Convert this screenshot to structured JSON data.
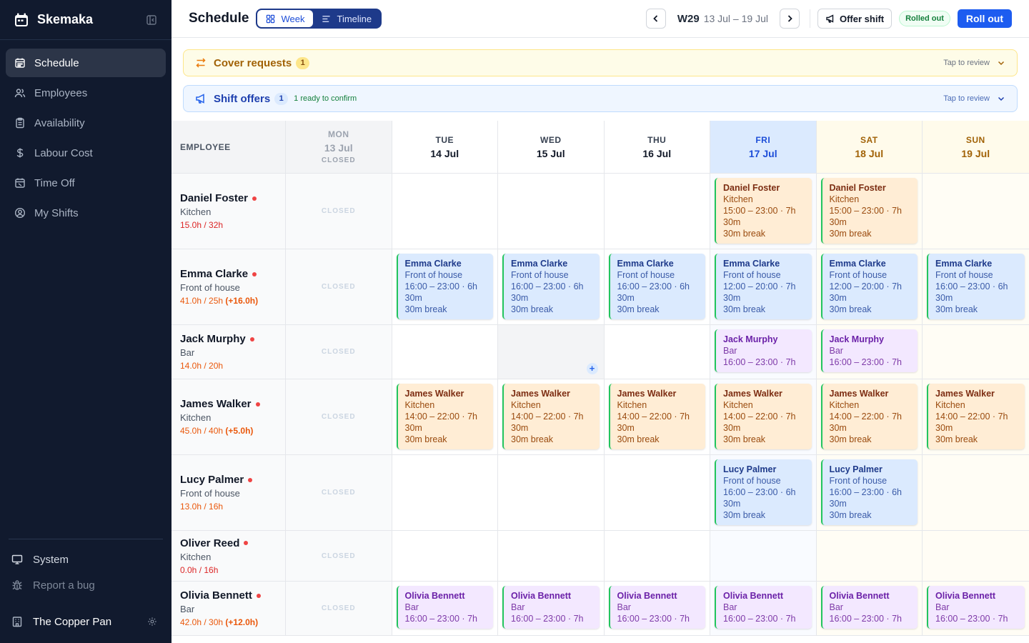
{
  "app": {
    "name": "Skemaka"
  },
  "sidebar": {
    "items": [
      {
        "label": "Schedule",
        "icon": "calendar-icon",
        "active": true
      },
      {
        "label": "Employees",
        "icon": "users-icon",
        "active": false
      },
      {
        "label": "Availability",
        "icon": "clipboard-icon",
        "active": false
      },
      {
        "label": "Labour Cost",
        "icon": "dollar-icon",
        "active": false
      },
      {
        "label": "Time Off",
        "icon": "calendar-off-icon",
        "active": false
      },
      {
        "label": "My Shifts",
        "icon": "user-circle-icon",
        "active": false
      }
    ],
    "system_label": "System",
    "report_label": "Report a bug",
    "org_name": "The Copper Pan"
  },
  "header": {
    "title": "Schedule",
    "views": {
      "week": "Week",
      "timeline": "Timeline"
    },
    "week_code": "W29",
    "week_range": "13 Jul – 19 Jul",
    "offer_shift_label": "Offer shift",
    "status_badge": "Rolled out",
    "rollout_label": "Roll out"
  },
  "banners": {
    "cover": {
      "title": "Cover requests",
      "count": "1",
      "tap": "Tap to review"
    },
    "offers": {
      "title": "Shift offers",
      "count": "1",
      "ready": "1 ready to confirm",
      "tap": "Tap to review"
    }
  },
  "grid": {
    "employee_header": "EMPLOYEE",
    "closed_label": "CLOSED",
    "days": [
      {
        "name": "MON",
        "date": "13 Jul",
        "closed_note": "CLOSED"
      },
      {
        "name": "TUE",
        "date": "14 Jul"
      },
      {
        "name": "WED",
        "date": "15 Jul"
      },
      {
        "name": "THU",
        "date": "16 Jul"
      },
      {
        "name": "FRI",
        "date": "17 Jul"
      },
      {
        "name": "SAT",
        "date": "18 Jul"
      },
      {
        "name": "SUN",
        "date": "19 Jul"
      }
    ],
    "employees": [
      {
        "name": "Daniel Foster",
        "role": "Kitchen",
        "hours": "15.0h / 32h",
        "over": ""
      },
      {
        "name": "Emma Clarke",
        "role": "Front of house",
        "hours": "41.0h / 25h",
        "over": "(+16.0h)"
      },
      {
        "name": "Jack Murphy",
        "role": "Bar",
        "hours": "14.0h / 20h",
        "over": ""
      },
      {
        "name": "James Walker",
        "role": "Kitchen",
        "hours": "45.0h / 40h",
        "over": "(+5.0h)"
      },
      {
        "name": "Lucy Palmer",
        "role": "Front of house",
        "hours": "13.0h / 16h",
        "over": ""
      },
      {
        "name": "Oliver Reed",
        "role": "Kitchen",
        "hours": "0.0h / 16h",
        "over": ""
      },
      {
        "name": "Olivia Bennett",
        "role": "Bar",
        "hours": "42.0h / 30h",
        "over": "(+12.0h)"
      }
    ],
    "shifts": {
      "daniel_kitchen": {
        "name": "Daniel Foster",
        "role": "Kitchen",
        "time": "15:00 – 23:00 · 7h",
        "time2": "30m",
        "break": "30m break"
      },
      "emma_late": {
        "name": "Emma Clarke",
        "role": "Front of house",
        "time": "16:00 – 23:00 · 6h",
        "time2": "30m",
        "break": "30m break"
      },
      "emma_mid": {
        "name": "Emma Clarke",
        "role": "Front of house",
        "time": "12:00 – 20:00 · 7h",
        "time2": "30m",
        "break": "30m break"
      },
      "jack_bar": {
        "name": "Jack Murphy",
        "role": "Bar",
        "time": "16:00 – 23:00 · 7h"
      },
      "james_kitchen": {
        "name": "James Walker",
        "role": "Kitchen",
        "time": "14:00 – 22:00 · 7h",
        "time2": "30m",
        "break": "30m break"
      },
      "lucy_foh": {
        "name": "Lucy Palmer",
        "role": "Front of house",
        "time": "16:00 – 23:00 · 6h",
        "time2": "30m",
        "break": "30m break"
      },
      "olivia_bar": {
        "name": "Olivia Bennett",
        "role": "Bar",
        "time": "16:00 – 23:00 · 7h"
      }
    }
  },
  "colors": {
    "sidebar_bg": "#111a2e",
    "accent": "#1d5cf0",
    "kitchen": "#ffedd5",
    "front_of_house": "#dbeafe",
    "bar": "#f3e8ff"
  }
}
